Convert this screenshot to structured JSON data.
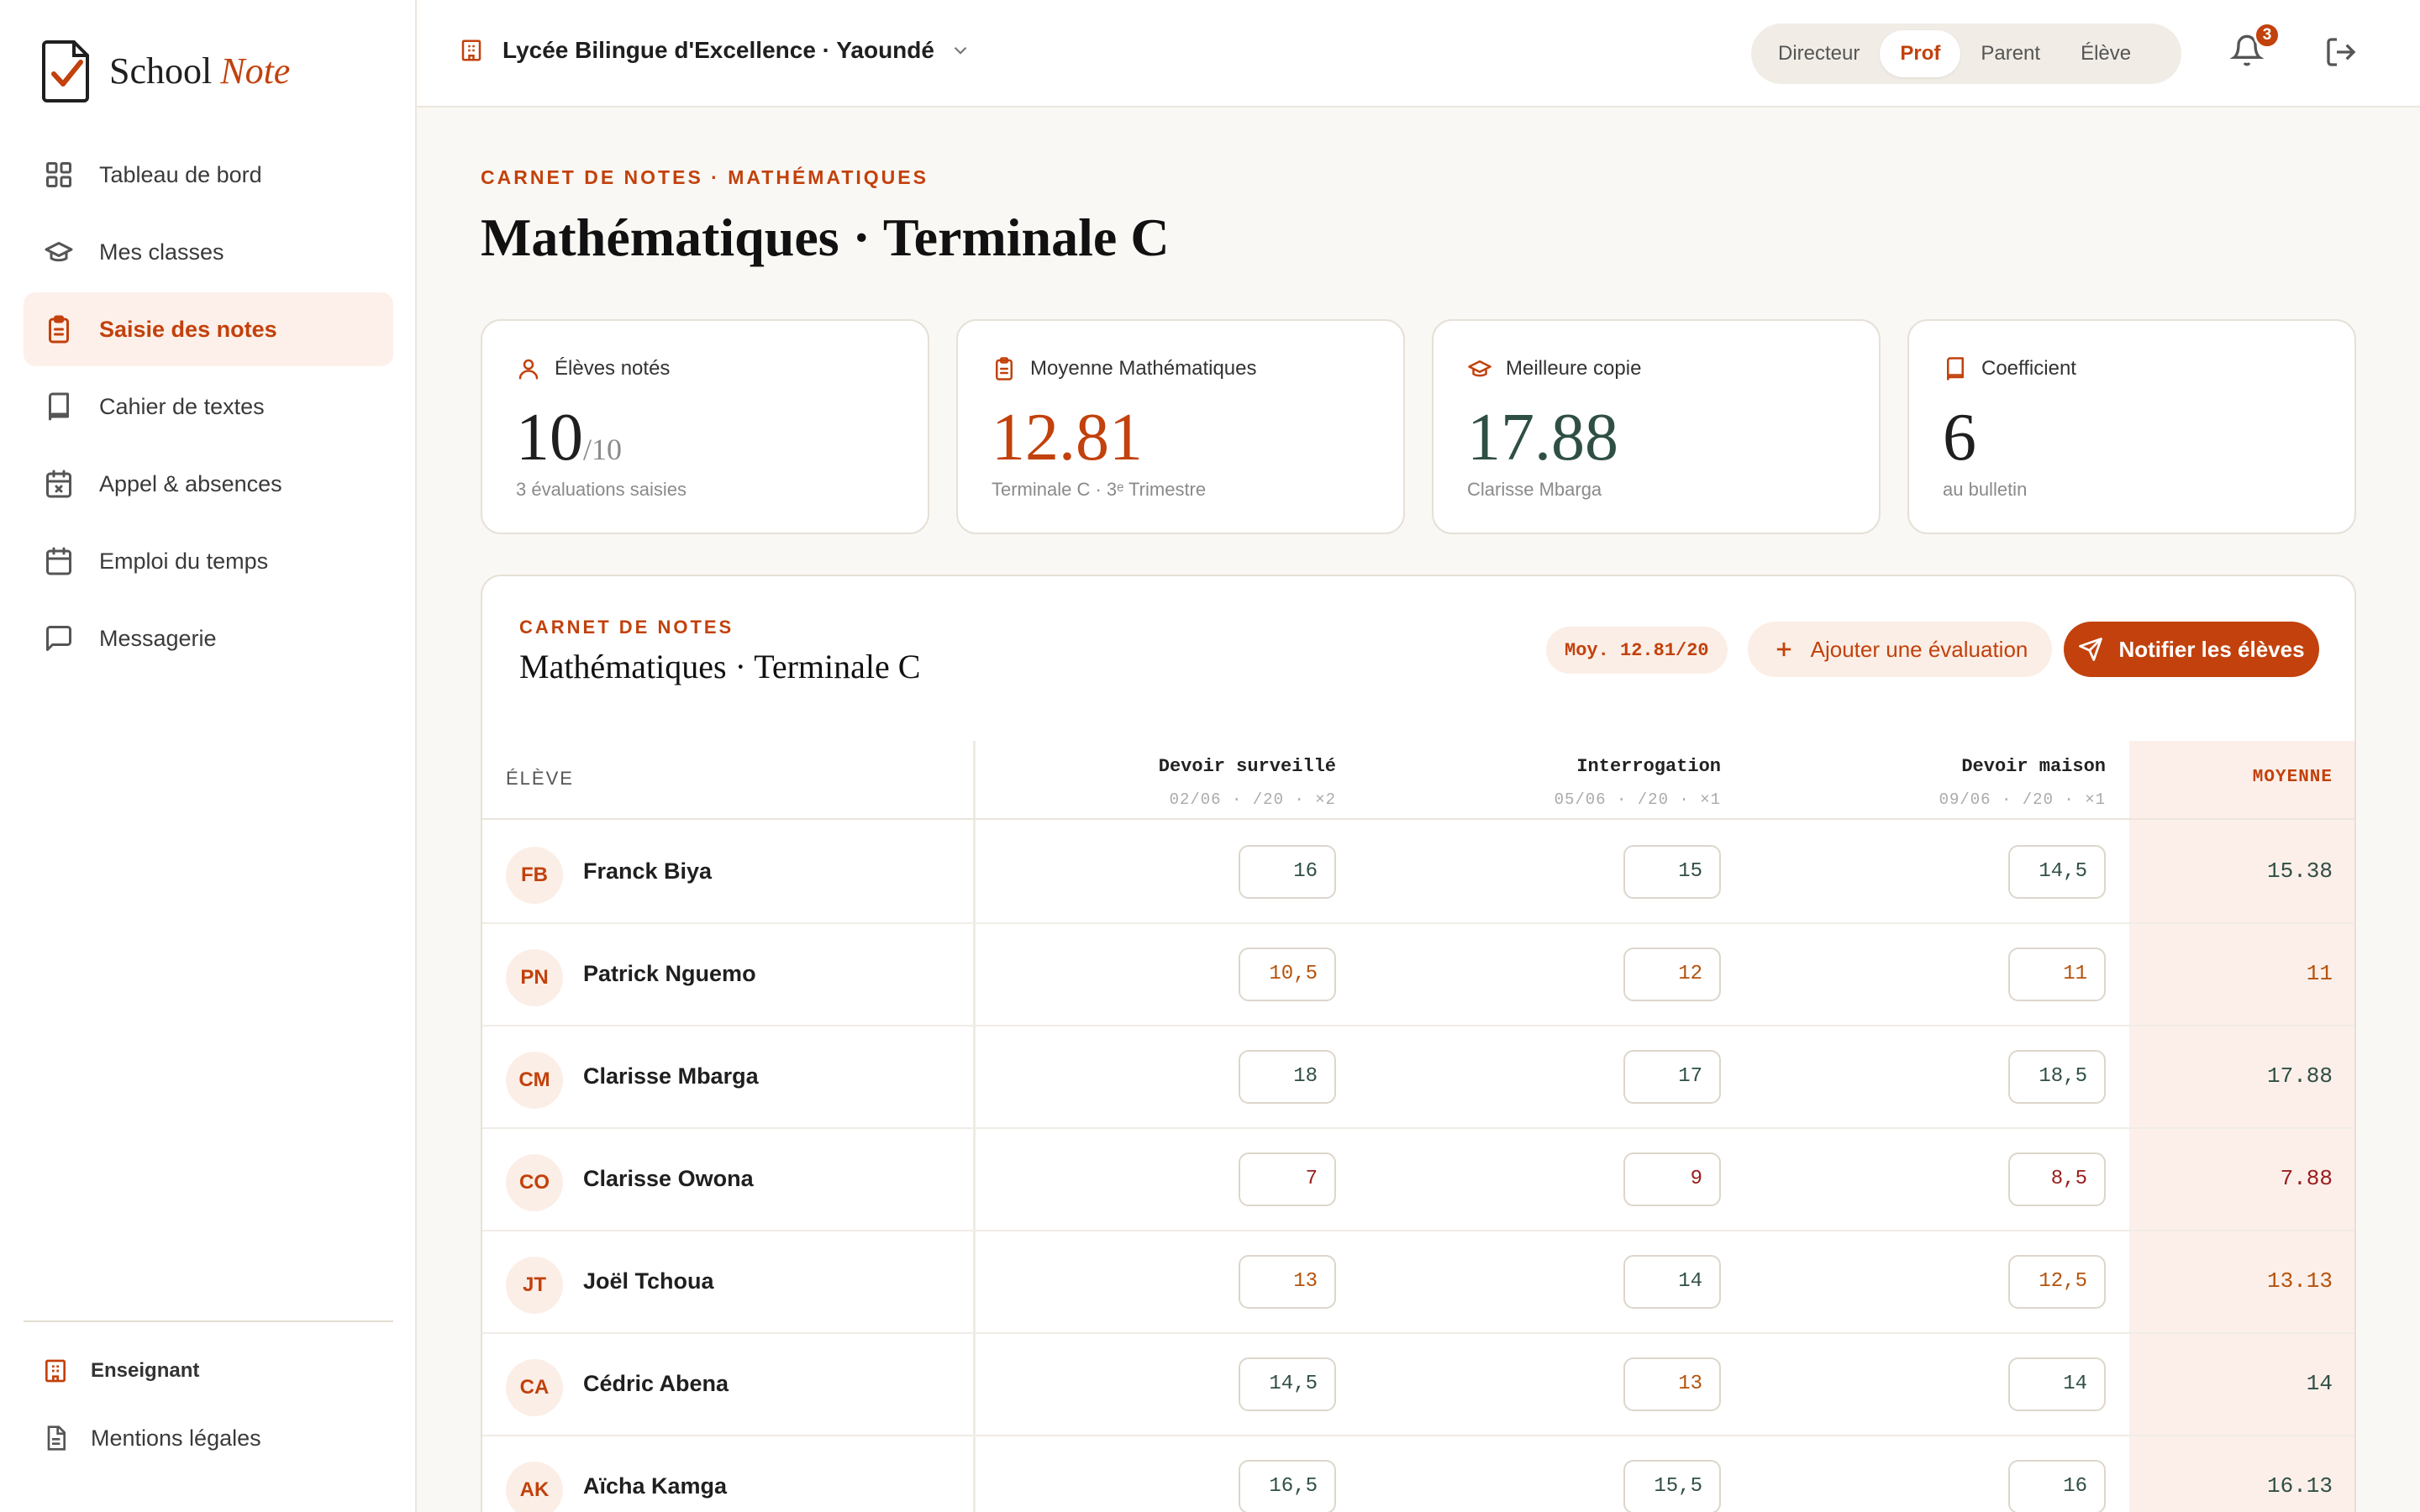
{
  "brand": {
    "name": "School",
    "accent": "Note"
  },
  "nav": [
    {
      "label": "Tableau de bord",
      "icon": "grid-icon"
    },
    {
      "label": "Mes classes",
      "icon": "graduation-cap-icon"
    },
    {
      "label": "Saisie des notes",
      "icon": "clipboard-icon",
      "active": true
    },
    {
      "label": "Cahier de textes",
      "icon": "book-icon"
    },
    {
      "label": "Appel & absences",
      "icon": "calendar-x-icon"
    },
    {
      "label": "Emploi du temps",
      "icon": "calendar-icon"
    },
    {
      "label": "Messagerie",
      "icon": "chat-icon"
    }
  ],
  "sidebar_footer": {
    "role_label": "Enseignant",
    "legal_label": "Mentions légales"
  },
  "topbar": {
    "school": "Lycée Bilingue d'Excellence · Yaoundé",
    "roles": [
      "Directeur",
      "Prof",
      "Parent",
      "Élève"
    ],
    "active_role": "Prof",
    "notifications": "3"
  },
  "page": {
    "eyebrow": "CARNET DE NOTES · MATHÉMATIQUES",
    "title": "Mathématiques · Terminale C"
  },
  "stats": [
    {
      "label": "Élèves notés",
      "value": "10",
      "suffix": "/10",
      "sub": "3 évaluations saisies",
      "icon": "user-icon",
      "color": "#1f1f1f"
    },
    {
      "label": "Moyenne Mathématiques",
      "value": "12.81",
      "suffix": "",
      "sub": "Terminale C · 3ᵉ Trimestre",
      "icon": "clipboard-icon",
      "color": "#c2410c"
    },
    {
      "label": "Meilleure copie",
      "value": "17.88",
      "suffix": "",
      "sub": "Clarisse Mbarga",
      "icon": "graduation-cap-icon",
      "color": "#2f4f45"
    },
    {
      "label": "Coefficient",
      "value": "6",
      "suffix": "",
      "sub": "au bulletin",
      "icon": "book-icon",
      "color": "#1f1f1f"
    }
  ],
  "gradebook": {
    "eyebrow": "CARNET DE NOTES",
    "title": "Mathématiques · Terminale C",
    "avg_chip": "Moy. 12.81/20",
    "add_label": "Ajouter une évaluation",
    "notify_label": "Notifier les élèves",
    "student_header": "ÉLÈVE",
    "average_header": "MOYENNE",
    "evaluations": [
      {
        "name": "Devoir surveillé",
        "meta": "02/06 · /20 · ×2"
      },
      {
        "name": "Interrogation",
        "meta": "05/06 · /20 · ×1"
      },
      {
        "name": "Devoir maison",
        "meta": "09/06 · /20 · ×1"
      }
    ],
    "rows": [
      {
        "initials": "FB",
        "name": "Franck Biya",
        "grades": [
          "16",
          "15",
          "14,5"
        ],
        "levels": [
          "ok",
          "ok",
          "ok"
        ],
        "average": "15.38",
        "avg_level": "ok"
      },
      {
        "initials": "PN",
        "name": "Patrick Nguemo",
        "grades": [
          "10,5",
          "12",
          "11"
        ],
        "levels": [
          "mid",
          "mid",
          "mid"
        ],
        "average": "11",
        "avg_level": "mid"
      },
      {
        "initials": "CM",
        "name": "Clarisse Mbarga",
        "grades": [
          "18",
          "17",
          "18,5"
        ],
        "levels": [
          "ok",
          "ok",
          "ok"
        ],
        "average": "17.88",
        "avg_level": "ok"
      },
      {
        "initials": "CO",
        "name": "Clarisse Owona",
        "grades": [
          "7",
          "9",
          "8,5"
        ],
        "levels": [
          "low",
          "low",
          "low"
        ],
        "average": "7.88",
        "avg_level": "low"
      },
      {
        "initials": "JT",
        "name": "Joël Tchoua",
        "grades": [
          "13",
          "14",
          "12,5"
        ],
        "levels": [
          "mid",
          "ok",
          "mid"
        ],
        "average": "13.13",
        "avg_level": "mid"
      },
      {
        "initials": "CA",
        "name": "Cédric Abena",
        "grades": [
          "14,5",
          "13",
          "14"
        ],
        "levels": [
          "ok",
          "mid",
          "ok"
        ],
        "average": "14",
        "avg_level": "ok"
      },
      {
        "initials": "AK",
        "name": "Aïcha Kamga",
        "grades": [
          "16,5",
          "15,5",
          "16"
        ],
        "levels": [
          "ok",
          "ok",
          "ok"
        ],
        "average": "16.13",
        "avg_level": "ok"
      }
    ]
  },
  "colors": {
    "accent": "#c2410c",
    "good": "#2f4f45",
    "average": "#b4530d",
    "poor": "#9b1c1c"
  }
}
